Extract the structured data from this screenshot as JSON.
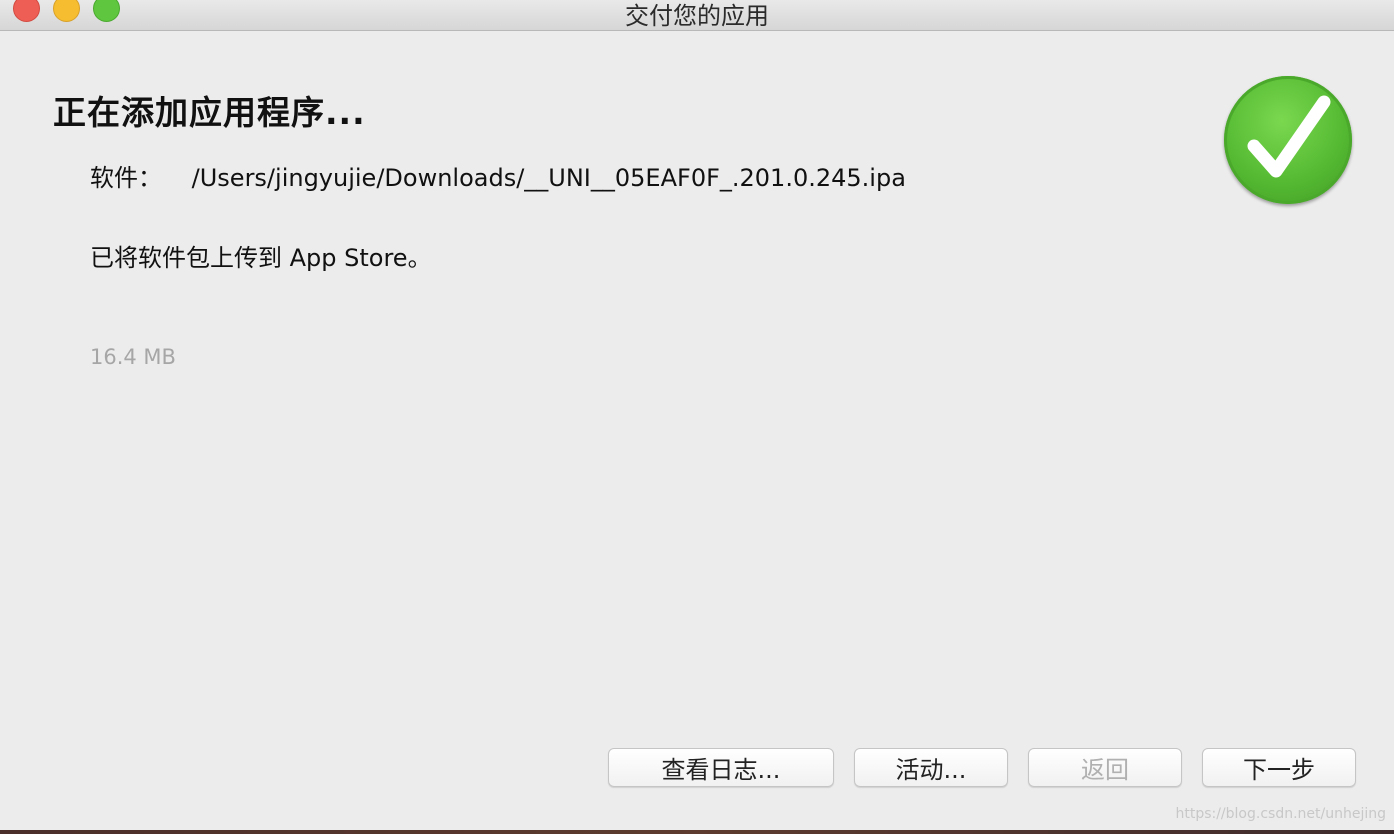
{
  "window": {
    "title": "交付您的应用"
  },
  "content": {
    "heading": "正在添加应用程序...",
    "software_label": "软件：",
    "software_path": "/Users/jingyujie/Downloads/__UNI__05EAF0F_.201.0.245.ipa",
    "status_message": "已将软件包上传到 App Store。",
    "file_size": "16.4 MB"
  },
  "buttons": {
    "view_log": "查看日志...",
    "activity": "活动...",
    "back": "返回",
    "next": "下一步"
  },
  "watermark": "https://blog.csdn.net/unhejing",
  "icons": {
    "success": "checkmark-success-icon"
  },
  "colors": {
    "success_green": "#56bb33",
    "window_bg": "#ececec",
    "muted_text": "#a6a6a6"
  }
}
